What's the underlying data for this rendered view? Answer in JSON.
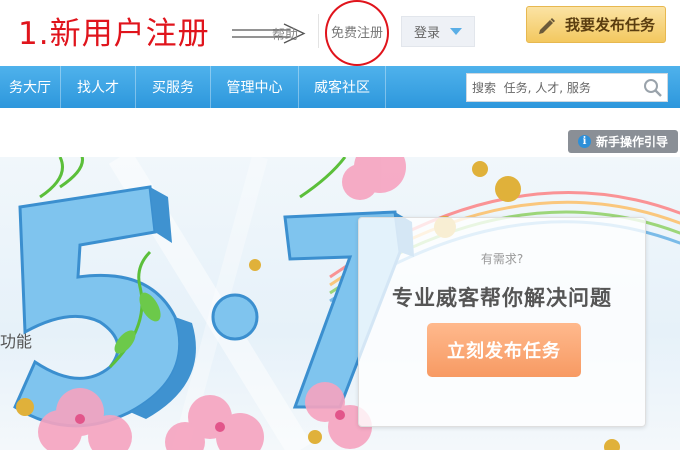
{
  "annotation": {
    "step_title": "1.新用户注册"
  },
  "header": {
    "help_label": "帮助",
    "register_label": "免费注册",
    "login_label": "登录",
    "publish_task_label": "我要发布任务"
  },
  "nav": {
    "items": [
      {
        "label": "务大厅"
      },
      {
        "label": "找人才"
      },
      {
        "label": "买服务"
      },
      {
        "label": "管理中心"
      },
      {
        "label": "威客社区"
      }
    ],
    "search_placeholder": "搜索  任务, 人才, 服务"
  },
  "guide": {
    "label": "新手操作引导"
  },
  "banner": {
    "side_text": "功能",
    "card": {
      "question": "有需求?",
      "title": "专业威客帮你解决问题",
      "button_label": "立刻发布任务"
    }
  },
  "colors": {
    "nav_blue": "#3aa5e6",
    "annotation_red": "#e0141c",
    "cta_orange": "#f79a63",
    "top_cta_gold": "#f3c85f"
  }
}
